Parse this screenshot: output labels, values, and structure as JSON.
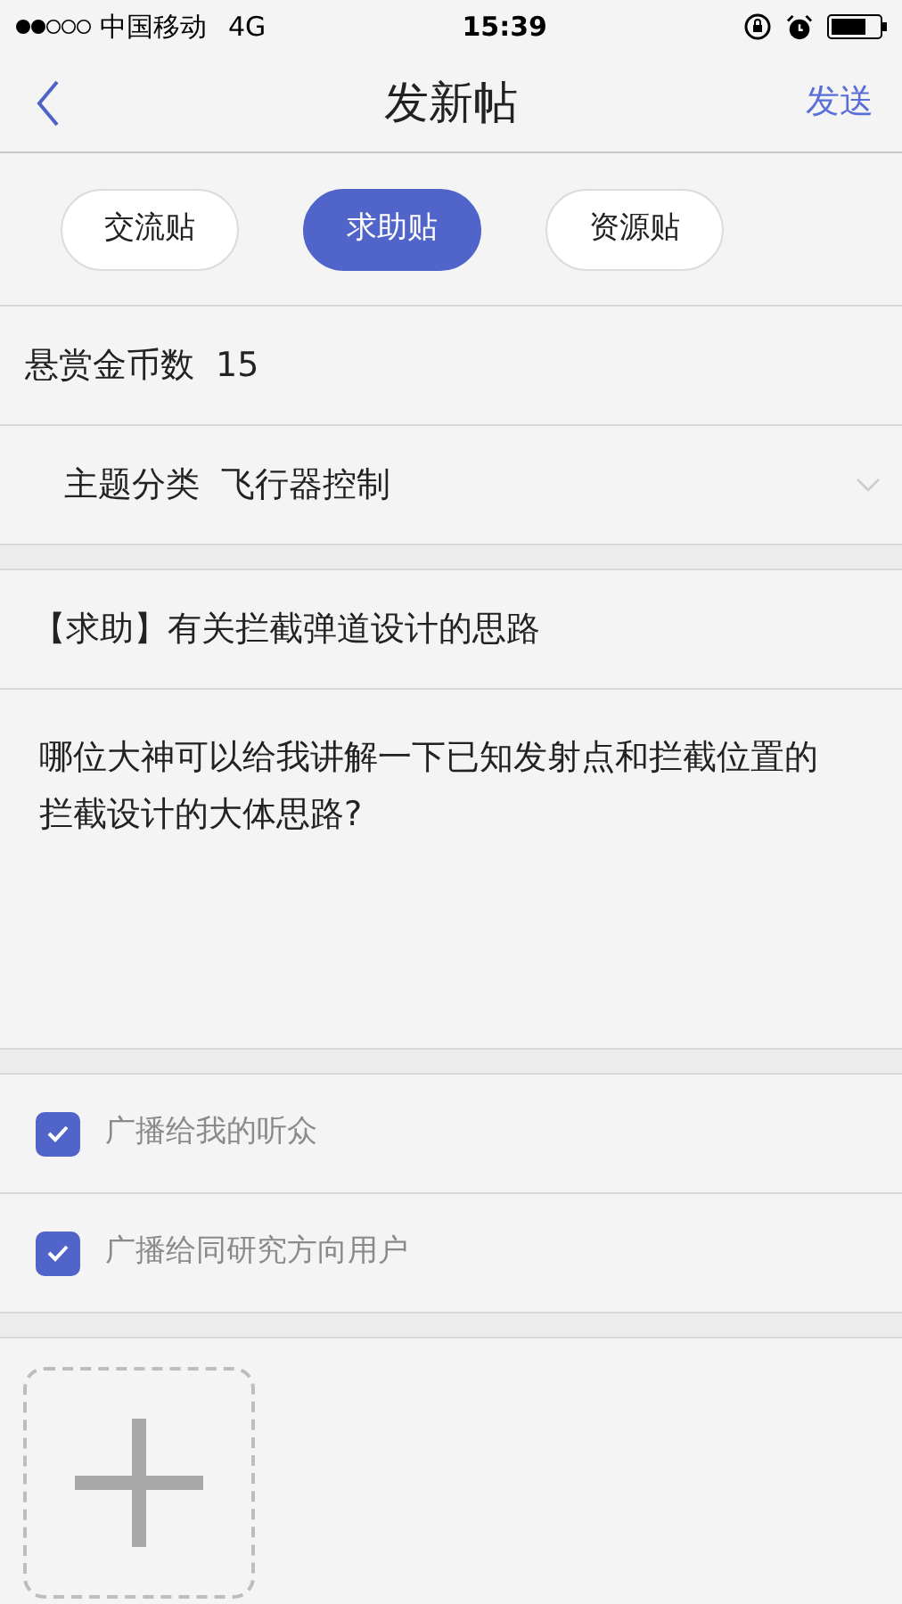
{
  "status_bar": {
    "carrier": "中国移动",
    "network": "4G",
    "time": "15:39"
  },
  "nav": {
    "title": "发新帖",
    "action": "发送"
  },
  "post_types": [
    {
      "label": "交流贴",
      "selected": false
    },
    {
      "label": "求助贴",
      "selected": true
    },
    {
      "label": "资源贴",
      "selected": false
    }
  ],
  "reward": {
    "label": "悬赏金币数",
    "value": "15"
  },
  "category": {
    "label": "主题分类",
    "value": "飞行器控制"
  },
  "post_title": "【求助】有关拦截弹道设计的思路",
  "post_body": "哪位大神可以给我讲解一下已知发射点和拦截位置的拦截设计的大体思路?",
  "broadcast_options": [
    {
      "label": "广播给我的听众",
      "checked": true
    },
    {
      "label": "广播给同研究方向用户",
      "checked": true
    }
  ]
}
